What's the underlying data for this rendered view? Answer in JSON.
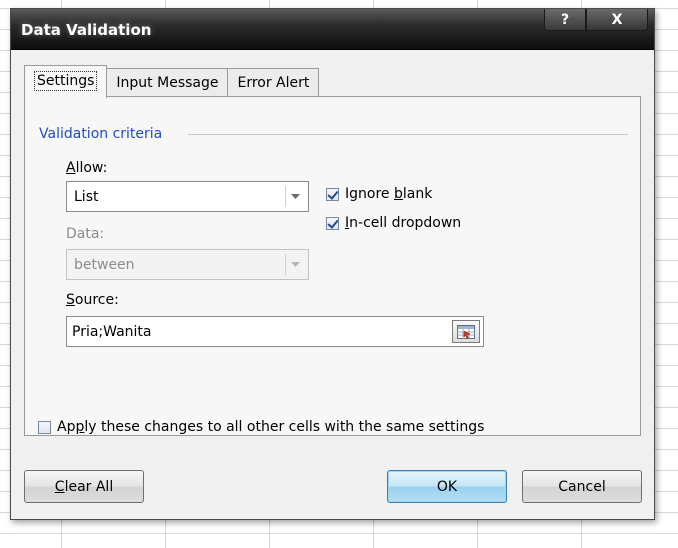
{
  "dialog": {
    "title": "Data Validation",
    "help_button": "?",
    "close_button": "X"
  },
  "tabs": [
    "Settings",
    "Input Message",
    "Error Alert"
  ],
  "settings": {
    "group_label": "Validation criteria",
    "allow_label": "Allow:",
    "allow_value": "List",
    "data_label": "Data:",
    "data_value": "between",
    "ignore_blank_label": "Ignore blank",
    "ignore_blank_checked": true,
    "in_cell_dropdown_label": "In-cell dropdown",
    "in_cell_dropdown_checked": true,
    "source_label": "Source:",
    "source_value": "Pria;Wanita",
    "apply_all_label": "Apply these changes to all other cells with the same settings",
    "apply_all_checked": false
  },
  "buttons": {
    "clear_all": "Clear All",
    "ok": "OK",
    "cancel": "Cancel"
  },
  "icons": {
    "dropdown": "chevron-down-icon",
    "range_select": "range-select-icon"
  }
}
